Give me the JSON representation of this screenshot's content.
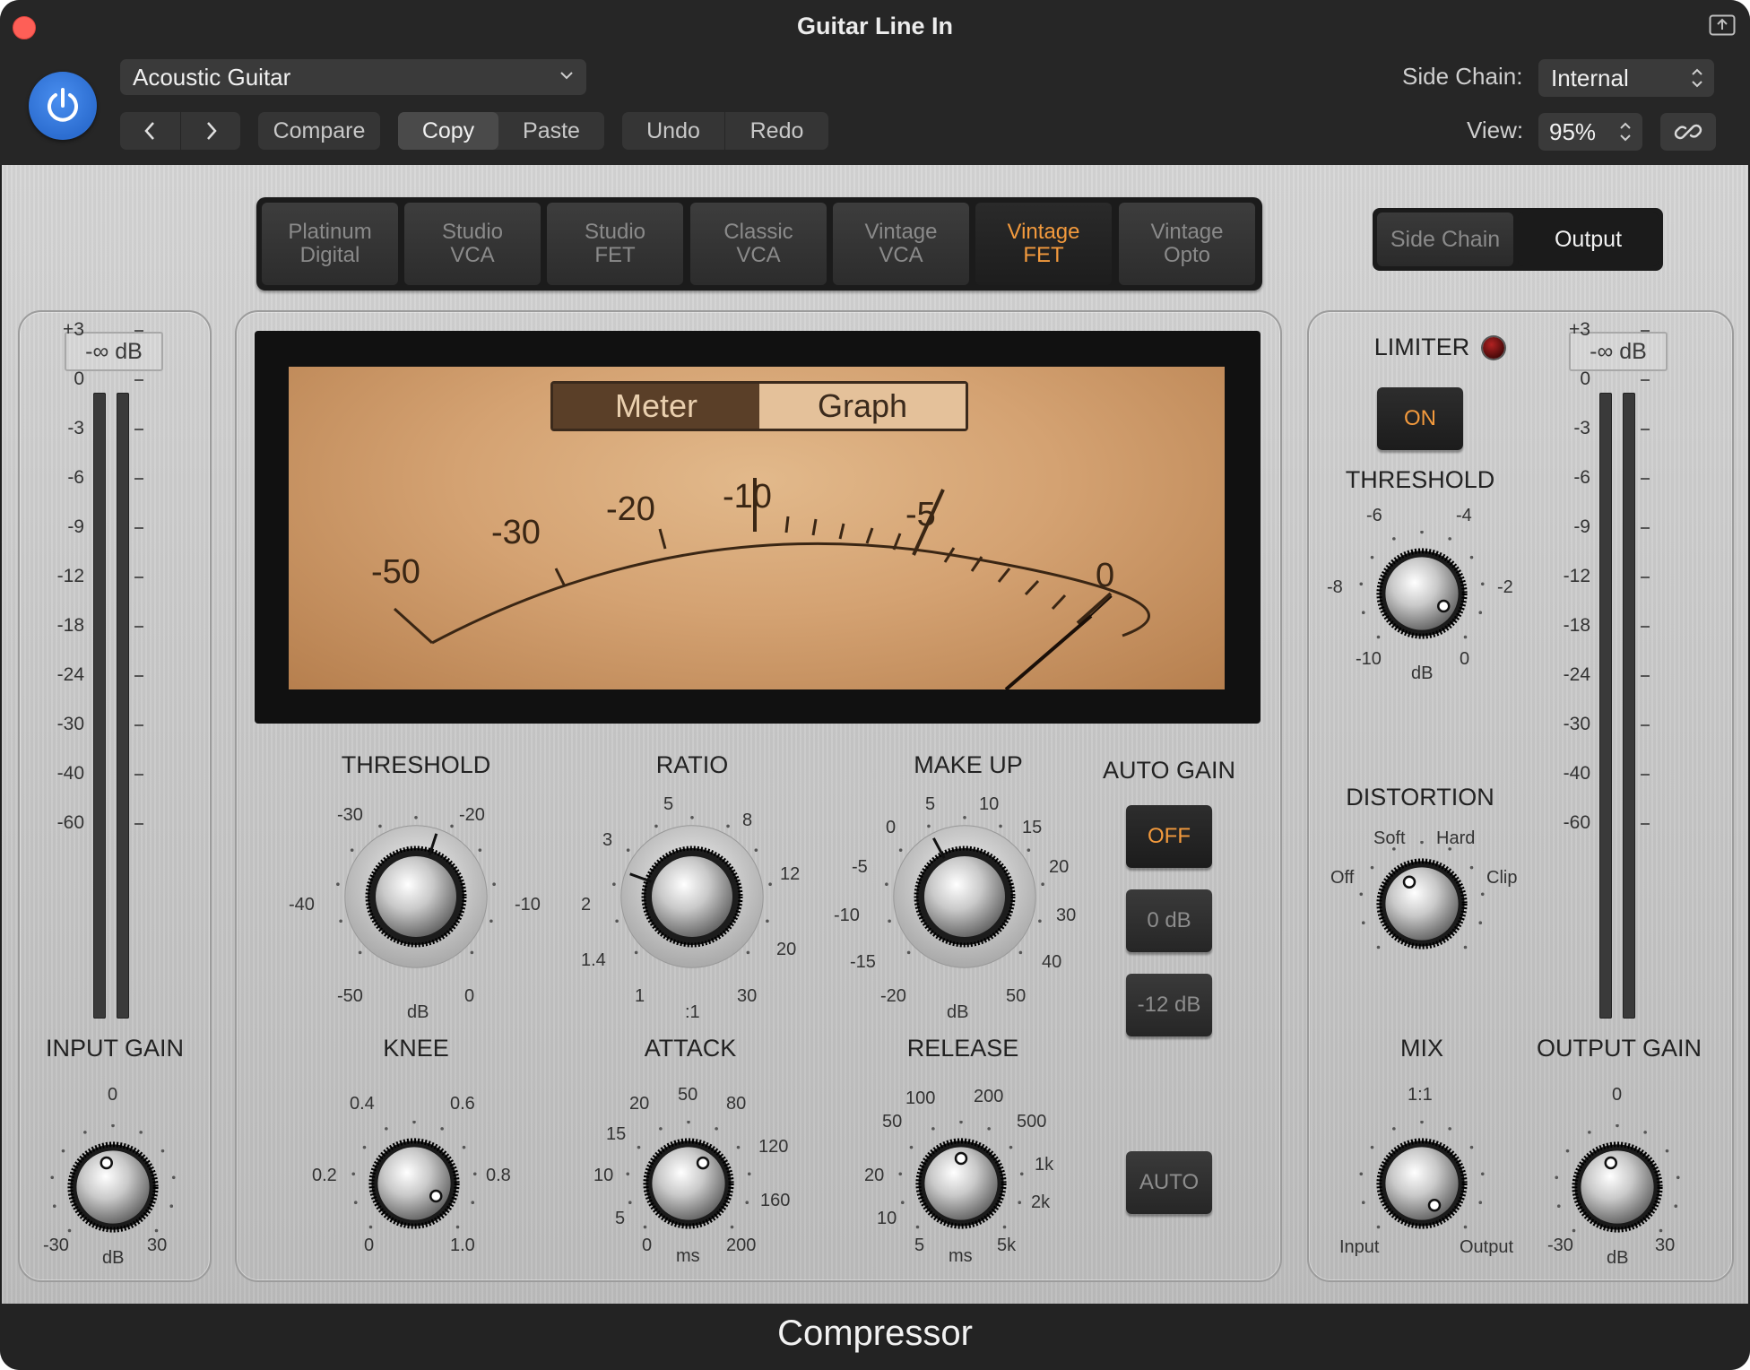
{
  "window": {
    "title": "Guitar Line In"
  },
  "header": {
    "preset": "Acoustic Guitar",
    "compare_label": "Compare",
    "copy_label": "Copy",
    "paste_label": "Paste",
    "undo_label": "Undo",
    "redo_label": "Redo",
    "sidechain_label": "Side Chain:",
    "sidechain_value": "Internal",
    "view_label": "View:",
    "view_value": "95%"
  },
  "circuit_types": [
    {
      "line1": "Platinum",
      "line2": "Digital",
      "selected": false
    },
    {
      "line1": "Studio",
      "line2": "VCA",
      "selected": false
    },
    {
      "line1": "Studio",
      "line2": "FET",
      "selected": false
    },
    {
      "line1": "Classic",
      "line2": "VCA",
      "selected": false
    },
    {
      "line1": "Vintage",
      "line2": "VCA",
      "selected": false
    },
    {
      "line1": "Vintage",
      "line2": "FET",
      "selected": true
    },
    {
      "line1": "Vintage",
      "line2": "Opto",
      "selected": false
    }
  ],
  "view_tabs": {
    "sidechain": "Side Chain",
    "output": "Output",
    "selected": "output"
  },
  "input": {
    "readout": "-∞ dB",
    "scale": [
      "+3",
      "0",
      "-3",
      "-6",
      "-9",
      "-12",
      "-18",
      "-24",
      "-30",
      "-40",
      "-60"
    ],
    "gain_title": "INPUT GAIN",
    "gain_top": "0",
    "gain_min": "-30",
    "gain_max": "30",
    "gain_unit": "dB"
  },
  "vu": {
    "meter_label": "Meter",
    "graph_label": "Graph",
    "selected": "meter",
    "scale": [
      "-50",
      "-30",
      "-20",
      "-10",
      "-5",
      "0"
    ]
  },
  "threshold": {
    "title": "THRESHOLD",
    "labels": [
      "-30",
      "-20",
      "-40",
      "-10",
      "-50",
      "0"
    ],
    "unit": "dB"
  },
  "ratio": {
    "title": "RATIO",
    "labels": [
      "5",
      "8",
      "3",
      "12",
      "2",
      "1.4",
      "20",
      "1",
      "30"
    ],
    "unit": ":1"
  },
  "makeup": {
    "title": "MAKE UP",
    "labels": [
      "5",
      "10",
      "0",
      "15",
      "-5",
      "20",
      "-10",
      "30",
      "-15",
      "40",
      "-20",
      "50"
    ],
    "unit": "dB"
  },
  "auto_gain": {
    "title": "AUTO GAIN",
    "off": "OFF",
    "zero": "0 dB",
    "minus12": "-12 dB",
    "selected": "off"
  },
  "knee": {
    "title": "KNEE",
    "labels": [
      "0.4",
      "0.6",
      "0.2",
      "0.8",
      "0",
      "1.0"
    ]
  },
  "attack": {
    "title": "ATTACK",
    "labels": [
      "50",
      "20",
      "80",
      "15",
      "120",
      "10",
      "160",
      "5",
      "0",
      "200"
    ],
    "unit": "ms"
  },
  "release": {
    "title": "RELEASE",
    "labels": [
      "100",
      "200",
      "50",
      "500",
      "20",
      "1k",
      "10",
      "2k",
      "5",
      "5k"
    ],
    "unit": "ms",
    "auto": "AUTO"
  },
  "limiter": {
    "title": "LIMITER",
    "on_label": "ON",
    "threshold_title": "THRESHOLD",
    "labels": [
      "-6",
      "-4",
      "-8",
      "-2",
      "-10",
      "0"
    ],
    "unit": "dB"
  },
  "distortion": {
    "title": "DISTORTION",
    "labels": [
      "Soft",
      "Hard",
      "Off",
      "Clip"
    ]
  },
  "mix": {
    "title": "MIX",
    "top": "1:1",
    "left": "Input",
    "right": "Output"
  },
  "output": {
    "readout": "-∞ dB",
    "gain_title": "OUTPUT GAIN",
    "gain_top": "0",
    "gain_min": "-30",
    "gain_max": "30",
    "gain_unit": "dB"
  },
  "footer": {
    "plugin_name": "Compressor"
  },
  "colors": {
    "accent_orange": "#f39a3d",
    "power_blue": "#2c6dd0",
    "vu_face": "#d4a272"
  }
}
